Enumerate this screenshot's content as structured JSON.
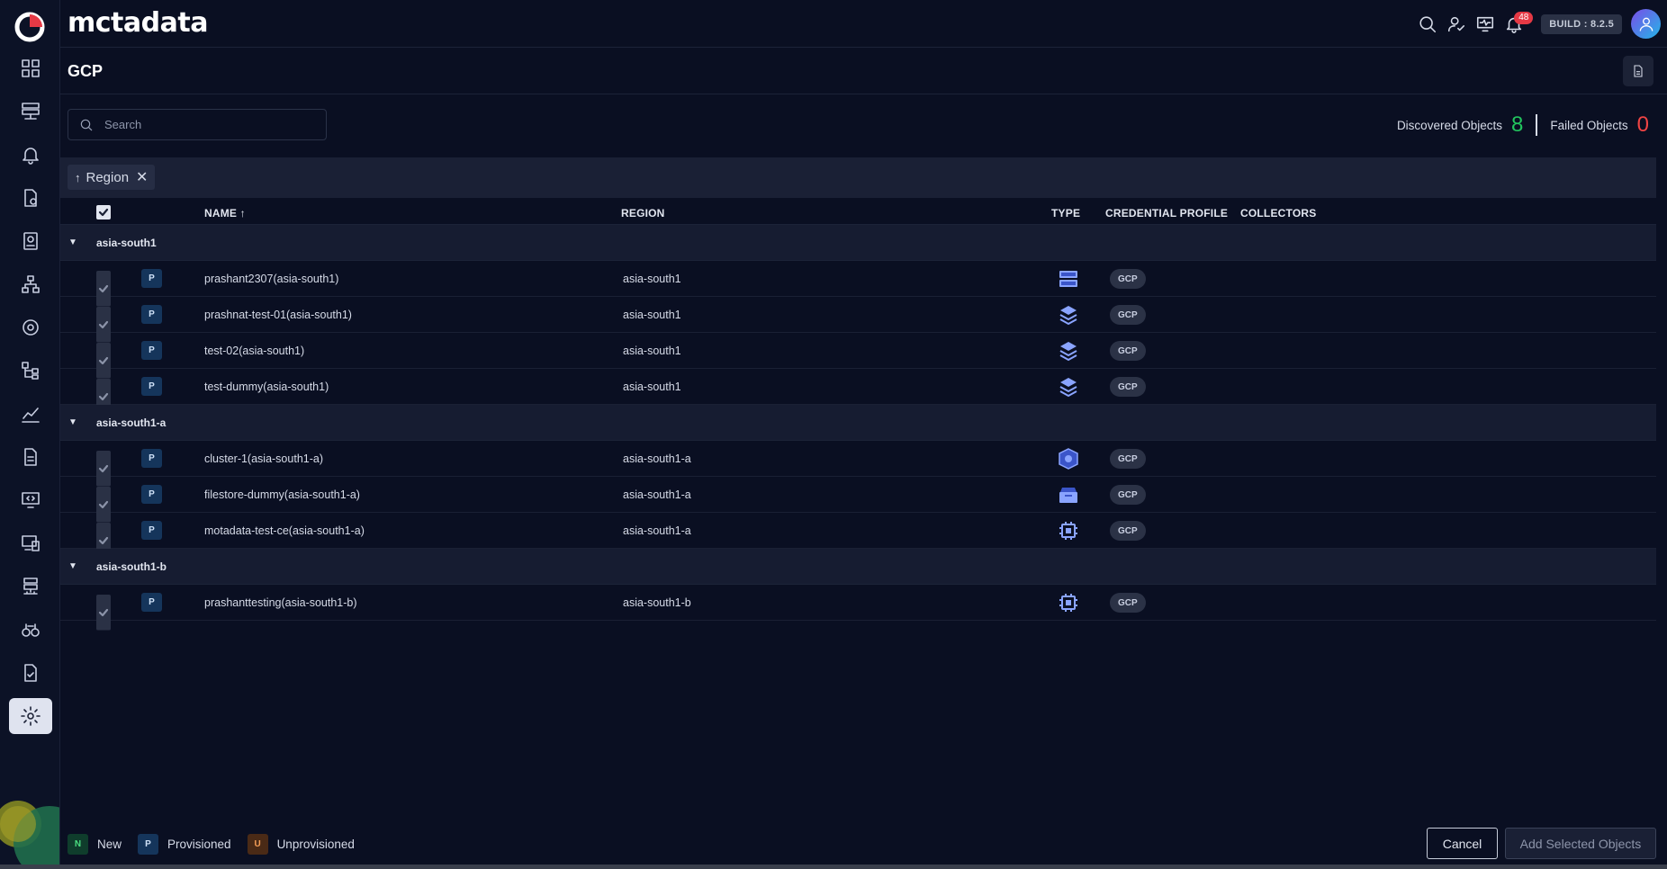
{
  "brand": {
    "name": "mctadata"
  },
  "topbar": {
    "notifications_count": "48",
    "build_label": "BUILD : 8.2.5"
  },
  "page": {
    "title": "GCP"
  },
  "search": {
    "placeholder": "Search"
  },
  "stats": {
    "discovered_label": "Discovered Objects",
    "discovered_value": "8",
    "failed_label": "Failed Objects",
    "failed_value": "0"
  },
  "group_by": {
    "arrow": "↑",
    "label": "Region",
    "remove": "✕"
  },
  "table": {
    "columns": {
      "name": "NAME ↑",
      "region": "REGION",
      "type": "TYPE",
      "credential_profile": "CREDENTIAL PROFILE",
      "collectors": "COLLECTORS"
    },
    "groups": [
      {
        "name": "asia-south1",
        "rows": [
          {
            "status": "P",
            "name": "prashant2307(asia-south1)",
            "region": "asia-south1",
            "type_icon": "storage-bucket-icon",
            "credential": "GCP"
          },
          {
            "status": "P",
            "name": "prashnat-test-01(asia-south1)",
            "region": "asia-south1",
            "type_icon": "layers-icon",
            "credential": "GCP"
          },
          {
            "status": "P",
            "name": "test-02(asia-south1)",
            "region": "asia-south1",
            "type_icon": "layers-icon",
            "credential": "GCP"
          },
          {
            "status": "P",
            "name": "test-dummy(asia-south1)",
            "region": "asia-south1",
            "type_icon": "layers-icon",
            "credential": "GCP"
          }
        ]
      },
      {
        "name": "asia-south1-a",
        "rows": [
          {
            "status": "P",
            "name": "cluster-1(asia-south1-a)",
            "region": "asia-south1-a",
            "type_icon": "kubernetes-hex-icon",
            "credential": "GCP"
          },
          {
            "status": "P",
            "name": "filestore-dummy(asia-south1-a)",
            "region": "asia-south1-a",
            "type_icon": "filestore-icon",
            "credential": "GCP"
          },
          {
            "status": "P",
            "name": "motadata-test-ce(asia-south1-a)",
            "region": "asia-south1-a",
            "type_icon": "cpu-chip-icon",
            "credential": "GCP"
          }
        ]
      },
      {
        "name": "asia-south1-b",
        "rows": [
          {
            "status": "P",
            "name": "prashanttesting(asia-south1-b)",
            "region": "asia-south1-b",
            "type_icon": "cpu-chip-icon",
            "credential": "GCP"
          }
        ]
      }
    ]
  },
  "legend": [
    {
      "code": "N",
      "label": "New"
    },
    {
      "code": "P",
      "label": "Provisioned"
    },
    {
      "code": "U",
      "label": "Unprovisioned"
    }
  ],
  "footer": {
    "cancel_label": "Cancel",
    "add_label": "Add Selected Objects"
  },
  "colors": {
    "accent_green": "#22c55e",
    "accent_red": "#ef4444",
    "badge_red": "#e53945",
    "provisioned_blue": "#15355b"
  }
}
